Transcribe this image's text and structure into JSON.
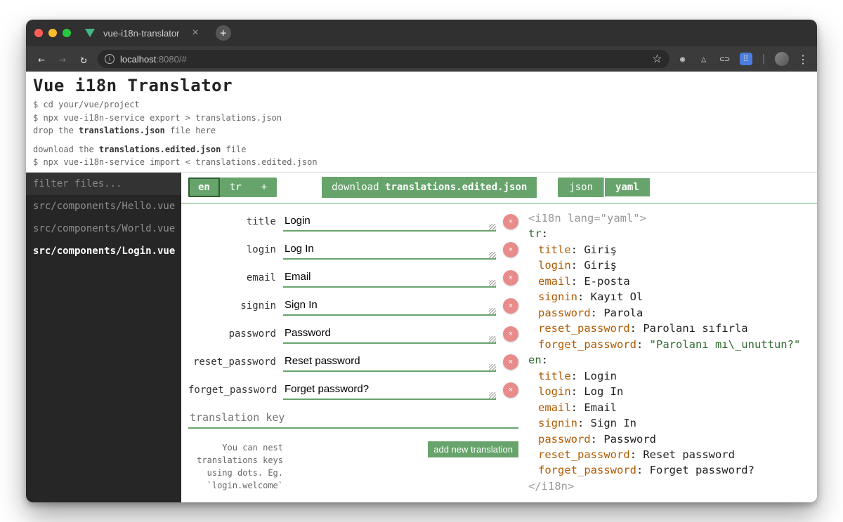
{
  "browser": {
    "tab_title": "vue-i18n-translator",
    "url_host": "localhost",
    "url_port": ":8080",
    "url_path": "/#"
  },
  "header": {
    "title": "Vue i18n Translator",
    "line1": "$ cd your/vue/project",
    "line2": "$ npx vue-i18n-service export > translations.json",
    "line3_prefix": "drop the ",
    "line3_bold": "translations.json",
    "line3_suffix": " file here",
    "line4_prefix": "download the ",
    "line4_bold": "translations.edited.json",
    "line4_suffix": " file",
    "line5": "$ npx vue-i18n-service import < translations.edited.json"
  },
  "sidebar": {
    "filter_placeholder": "filter files...",
    "files": [
      {
        "path": "src/components/Hello.vue",
        "active": false
      },
      {
        "path": "src/components/World.vue",
        "active": false
      },
      {
        "path": "src/components/Login.vue",
        "active": true
      }
    ]
  },
  "toolbar": {
    "langs": [
      "en",
      "tr"
    ],
    "lang_active": "en",
    "lang_add": "+",
    "download_prefix": "download ",
    "download_bold": "translations.edited.json",
    "formats": [
      "json",
      "yaml"
    ],
    "format_active": "yaml"
  },
  "editor": {
    "rows": [
      {
        "key": "title",
        "value": "Login"
      },
      {
        "key": "login",
        "value": "Log In"
      },
      {
        "key": "email",
        "value": "Email"
      },
      {
        "key": "signin",
        "value": "Sign In"
      },
      {
        "key": "password",
        "value": "Password"
      },
      {
        "key": "reset_password",
        "value": "Reset password"
      },
      {
        "key": "forget_password",
        "value": "Forget password?"
      }
    ],
    "newkey_placeholder": "translation key",
    "hint": "You can nest translations keys using dots. Eg. `login.welcome`",
    "addnew_label": "add new translation",
    "delete_label": "×"
  },
  "yaml": {
    "open_tag": "<i18n lang=\"yaml\">",
    "close_tag": "</i18n>",
    "tr": {
      "name": "tr",
      "entries": [
        {
          "k": "title",
          "v": "Giriş"
        },
        {
          "k": "login",
          "v": "Giriş"
        },
        {
          "k": "email",
          "v": "E-posta"
        },
        {
          "k": "signin",
          "v": "Kayıt Ol"
        },
        {
          "k": "password",
          "v": "Parola"
        },
        {
          "k": "reset_password",
          "v": "Parolanı sıfırla"
        },
        {
          "k": "forget_password",
          "v": "\"Parolanı mı\\_unuttun?\"",
          "quoted": true
        }
      ]
    },
    "en": {
      "name": "en",
      "entries": [
        {
          "k": "title",
          "v": "Login"
        },
        {
          "k": "login",
          "v": "Log In"
        },
        {
          "k": "email",
          "v": "Email"
        },
        {
          "k": "signin",
          "v": "Sign In"
        },
        {
          "k": "password",
          "v": "Password"
        },
        {
          "k": "reset_password",
          "v": "Reset password"
        },
        {
          "k": "forget_password",
          "v": "Forget password?"
        }
      ]
    }
  }
}
